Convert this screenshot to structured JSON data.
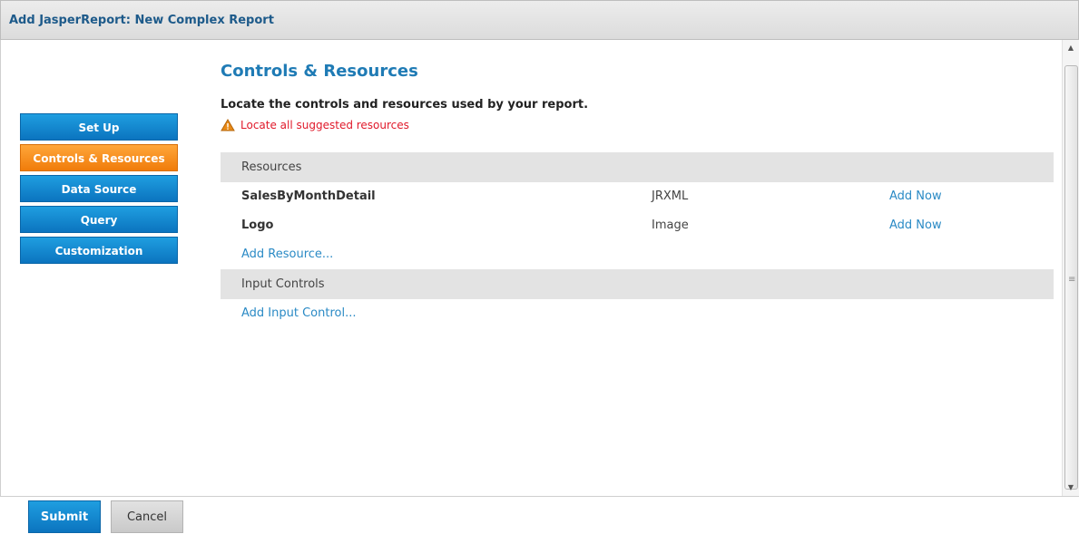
{
  "dialog": {
    "title": "Add JasperReport: New Complex Report"
  },
  "nav": {
    "items": [
      {
        "label": "Set Up"
      },
      {
        "label": "Controls & Resources",
        "active": true
      },
      {
        "label": "Data Source"
      },
      {
        "label": "Query"
      },
      {
        "label": "Customization"
      }
    ]
  },
  "main": {
    "title": "Controls & Resources",
    "subtitle": "Locate the controls and resources used by your report.",
    "warning": "Locate all suggested resources",
    "resources": {
      "header": "Resources",
      "rows": [
        {
          "name": "SalesByMonthDetail",
          "type": "JRXML",
          "action": "Add Now"
        },
        {
          "name": "Logo",
          "type": "Image",
          "action": "Add Now"
        }
      ],
      "add_link": "Add Resource..."
    },
    "input_controls": {
      "header": "Input Controls",
      "add_link": "Add Input Control..."
    }
  },
  "footer": {
    "submit_label": "Submit",
    "cancel_label": "Cancel"
  },
  "colors": {
    "accent": "#1f7bb5",
    "nav_blue": "#0b74bf",
    "nav_active": "#f07c0a",
    "warning": "#e0192a"
  }
}
